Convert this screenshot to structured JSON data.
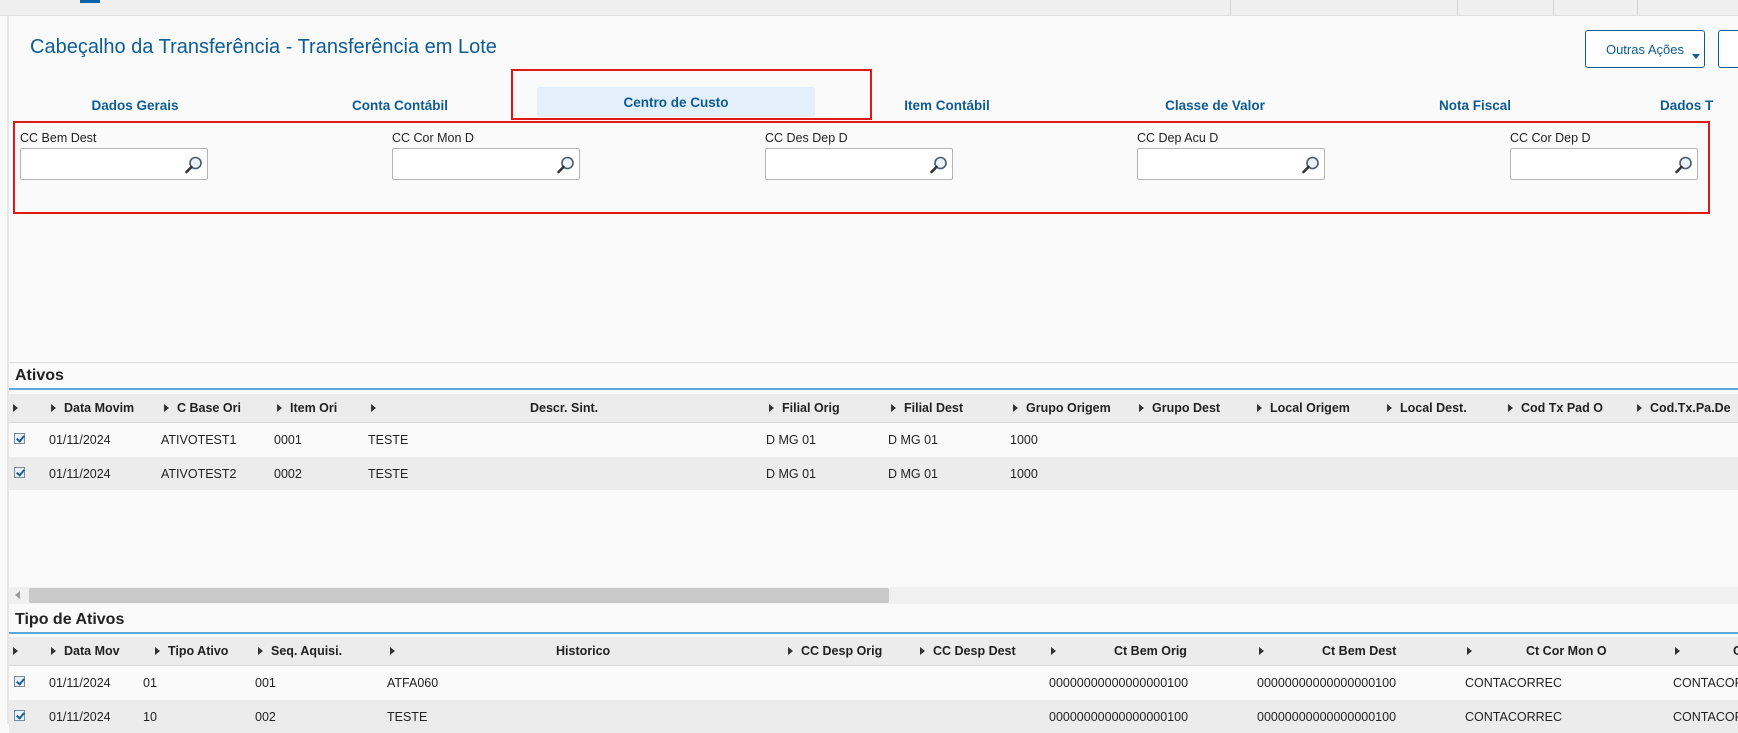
{
  "header": {
    "title": "Cabeçalho da Transferência - Transferência em Lote",
    "other_actions": "Outras Ações"
  },
  "tabs": [
    {
      "label": "Dados Gerais"
    },
    {
      "label": "Conta Contábil"
    },
    {
      "label": "Centro de Custo"
    },
    {
      "label": "Item Contábil"
    },
    {
      "label": "Classe de Valor"
    },
    {
      "label": "Nota Fiscal"
    },
    {
      "label": "Dados T"
    }
  ],
  "active_tab": "Centro de Custo",
  "fields": [
    {
      "label": "CC Bem Dest",
      "value": ""
    },
    {
      "label": "CC Cor Mon D",
      "value": ""
    },
    {
      "label": "CC Des Dep D",
      "value": ""
    },
    {
      "label": "CC Dep Acu D",
      "value": ""
    },
    {
      "label": "CC Cor Dep D",
      "value": ""
    }
  ],
  "ativos": {
    "title": "Ativos",
    "columns": [
      "Data Movim",
      "C Base Ori",
      "Item Ori",
      "",
      "Descr. Sint.",
      "Filial Orig",
      "Filial Dest",
      "Grupo Origem",
      "Grupo Dest",
      "Local Origem",
      "Local Dest.",
      "Cod Tx Pad O",
      "Cod.Tx.Pa.De"
    ],
    "rows": [
      {
        "checked": true,
        "data": "01/11/2024",
        "base": "ATIVOTEST1",
        "item": "0001",
        "descr": "TESTE",
        "filial_orig": "D MG 01",
        "filial_dest": "D MG 01",
        "grupo_origem": "1000"
      },
      {
        "checked": true,
        "data": "01/11/2024",
        "base": "ATIVOTEST2",
        "item": "0002",
        "descr": "TESTE",
        "filial_orig": "D MG 01",
        "filial_dest": "D MG 01",
        "grupo_origem": "1000"
      }
    ]
  },
  "tipo_ativos": {
    "title": "Tipo de Ativos",
    "columns": [
      "Data Mov",
      "Tipo Ativo",
      "Seq. Aquisi.",
      "",
      "Historico",
      "CC Desp Orig",
      "CC Desp Dest",
      "",
      "Ct Bem Orig",
      "",
      "Ct Bem Dest",
      "",
      "Ct Cor Mon O",
      "",
      "C"
    ],
    "rows": [
      {
        "checked": true,
        "data": "01/11/2024",
        "tipo": "01",
        "seq": "001",
        "hist": "ATFA060",
        "ct_bem_orig": "00000000000000000100",
        "ct_bem_dest": "00000000000000000100",
        "ct_cor_mon_o": "CONTACORREC",
        "last": "CONTACOR"
      },
      {
        "checked": true,
        "data": "01/11/2024",
        "tipo": "10",
        "seq": "002",
        "hist": "TESTE",
        "ct_bem_orig": "00000000000000000100",
        "ct_bem_dest": "00000000000000000100",
        "ct_cor_mon_o": "CONTACORREC",
        "last": "CONTACOR"
      }
    ]
  },
  "icons": {
    "lookup": "magnifier-icon",
    "checkbox": "checkbox-checked-icon",
    "column_toggle": "triangle-right-icon"
  },
  "colors": {
    "brand": "#0d5c95",
    "highlight": "#e01818",
    "section_rule": "#5aa6d9",
    "active_tab_bg": "#e3f0fb"
  }
}
